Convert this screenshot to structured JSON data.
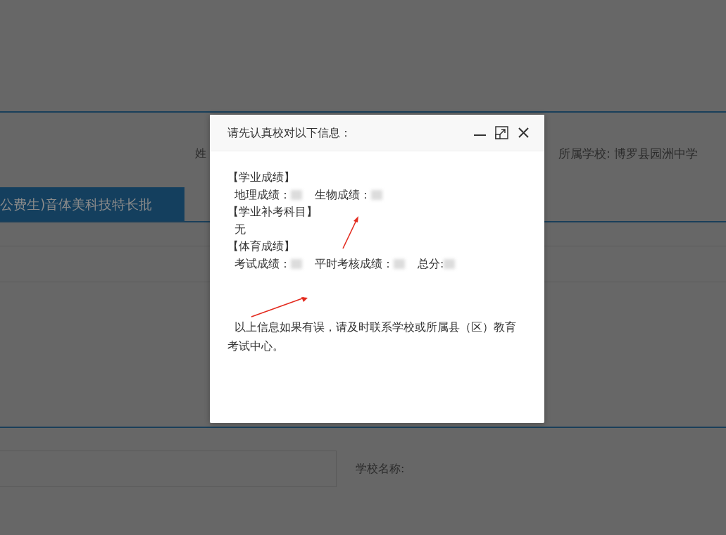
{
  "background": {
    "name_label": "姓",
    "school_label": "所属学校: 博罗县园洲中学",
    "tab": {
      "label": "公费生)音体美科技特长批",
      "selected": true
    },
    "school_name_label": "学校名称:"
  },
  "dialog": {
    "title": "请先认真校对以下信息：",
    "lines": [
      [
        {
          "kind": "heading",
          "text": "【学业成绩】"
        }
      ],
      [
        {
          "kind": "field",
          "text": "地理成绩："
        },
        {
          "kind": "field",
          "text": "生物成绩："
        }
      ],
      [
        {
          "kind": "heading",
          "text": "【学业补考科目】"
        }
      ],
      [
        {
          "kind": "text",
          "text": "无"
        }
      ],
      [
        {
          "kind": "heading",
          "text": "【体育成绩】"
        }
      ],
      [
        {
          "kind": "field",
          "text": "考试成绩："
        },
        {
          "kind": "field",
          "text": "平时考核成绩："
        },
        {
          "kind": "field",
          "text": "总分:"
        }
      ]
    ],
    "note": "以上信息如果有误，请及时联系学校或所属县（区）教育考试中心。"
  }
}
